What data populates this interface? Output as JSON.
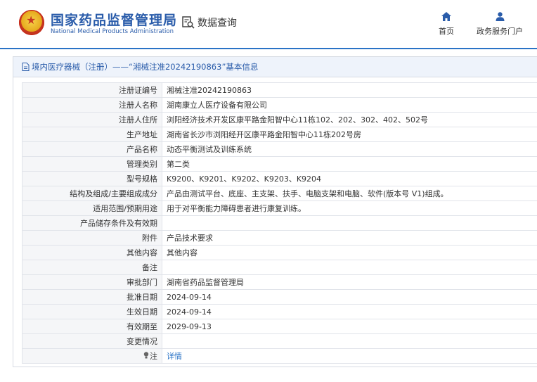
{
  "header": {
    "title": "国家药品监督管理局",
    "subtitle": "National Medical Products Administration",
    "query_label": "数据查询",
    "nav": [
      {
        "label": "首页",
        "icon": "home-icon"
      },
      {
        "label": "政务服务门户",
        "icon": "user-icon"
      }
    ]
  },
  "breadcrumb": "境内医疗器械（注册）——“湘械注准20242190863”基本信息",
  "rows": [
    {
      "label": "注册证编号",
      "value": "湘械注准20242190863"
    },
    {
      "label": "注册人名称",
      "value": "湖南康立人医疗设备有限公司"
    },
    {
      "label": "注册人住所",
      "value": "浏阳经济技术开发区康平路金阳智中心11栋102、202、302、402、502号"
    },
    {
      "label": "生产地址",
      "value": "湖南省长沙市浏阳经开区康平路金阳智中心11栋202号房"
    },
    {
      "label": "产品名称",
      "value": "动态平衡测试及训练系统"
    },
    {
      "label": "管理类别",
      "value": "第二类"
    },
    {
      "label": "型号规格",
      "value": "K9200、K9201、K9202、K9203、K9204"
    },
    {
      "label": "结构及组成/主要组成成分",
      "value": "产品由测试平台、底座、主支架、扶手、电脑支架和电脑、软件(版本号 V1)组成。"
    },
    {
      "label": "适用范围/预期用途",
      "value": "用于对平衡能力障碍患者进行康复训练。"
    },
    {
      "label": "产品储存条件及有效期",
      "value": ""
    },
    {
      "label": "附件",
      "value": "产品技术要求"
    },
    {
      "label": "其他内容",
      "value": "其他内容"
    },
    {
      "label": "备注",
      "value": ""
    },
    {
      "label": "审批部门",
      "value": "湖南省药品监督管理局"
    },
    {
      "label": "批准日期",
      "value": "2024-09-14"
    },
    {
      "label": "生效日期",
      "value": "2024-09-14"
    },
    {
      "label": "有效期至",
      "value": "2029-09-13"
    },
    {
      "label": "变更情况",
      "value": ""
    },
    {
      "label": "注",
      "value": "详情",
      "icon": "lightbulb-icon"
    }
  ],
  "colors": {
    "brand": "#2a5caa",
    "accent": "#2a73c6",
    "label_bg": "#f5f6f8"
  }
}
